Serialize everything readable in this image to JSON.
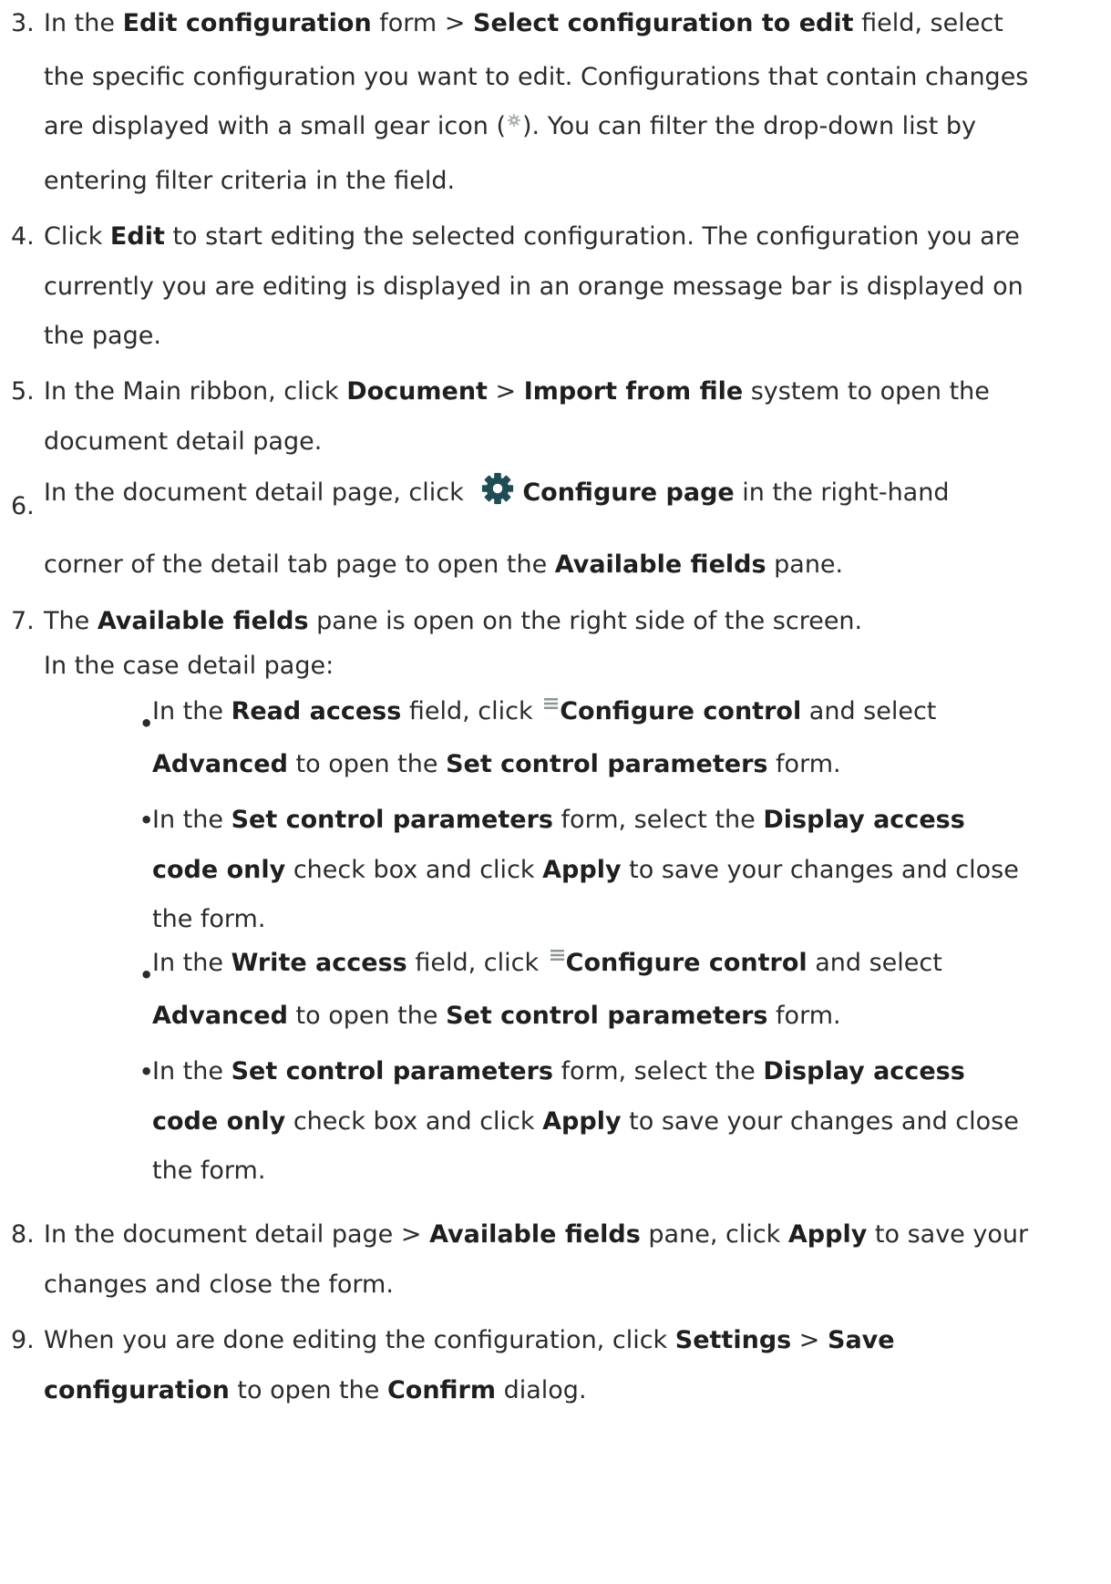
{
  "steps": {
    "s3": {
      "num": "3.",
      "l1a": "In the ",
      "l1b": "Edit configuration",
      "l1c": " form > ",
      "l1d": "Select configuration to edit",
      "l1e": " field, select",
      "l2": "the specific configuration you want to edit. Configurations that contain changes",
      "l3a": "are displayed with a small gear icon (",
      "l3b": "). You can filter the drop-down list by",
      "l4": "entering filter criteria in the field."
    },
    "s4": {
      "num": "4.",
      "l1a": "Click ",
      "l1b": "Edit",
      "l1c": " to start editing the selected configuration. The configuration you are",
      "l2": "currently you are editing is displayed in an orange message bar is displayed on",
      "l3": "the page."
    },
    "s5": {
      "num": "5.",
      "l1a": "In the Main ribbon, click ",
      "l1b": "Document",
      "l1c": " > ",
      "l1d": "Import from file",
      "l1e": " system to open the",
      "l2": "document detail page."
    },
    "s6": {
      "num": "6.",
      "l1a": "In the document detail page, click ",
      "l1b": "Configure page",
      "l1c": " in the right-hand",
      "l2a": "corner of the detail tab page to open the ",
      "l2b": "Available fields",
      "l2c": " pane."
    },
    "s7": {
      "num": "7.",
      "l1a": "The ",
      "l1b": "Available fields",
      "l1c": " pane is open on the right side of the screen.",
      "l2": "In the case detail page:",
      "b1": {
        "l1a": "In the ",
        "l1b": "Read access",
        "l1c": " field, click ",
        "l1d": "Configure control",
        "l1e": " and select",
        "l2a": "Advanced",
        "l2b": " to open the ",
        "l2c": "Set control parameters",
        "l2d": " form."
      },
      "b2": {
        "l1a": "In the ",
        "l1b": "Set control parameters",
        "l1c": " form, select the ",
        "l1d": "Display access",
        "l2a": "code only",
        "l2b": " check box and click ",
        "l2c": "Apply",
        "l2d": " to save your changes and close",
        "l3": "the form."
      },
      "b3": {
        "l1a": "In the ",
        "l1b": "Write access",
        "l1c": " field, click ",
        "l1d": "Configure control",
        "l1e": " and select",
        "l2a": "Advanced",
        "l2b": " to open the ",
        "l2c": "Set control parameters",
        "l2d": " form."
      },
      "b4": {
        "l1a": "In the ",
        "l1b": "Set control parameters",
        "l1c": " form, select the ",
        "l1d": "Display access",
        "l2a": "code only",
        "l2b": " check box and click ",
        "l2c": "Apply",
        "l2d": " to save your changes and close",
        "l3": "the form."
      }
    },
    "s8": {
      "num": "8.",
      "l1a": "In the document detail page > ",
      "l1b": "Available fields",
      "l1c": " pane, click ",
      "l1d": "Apply",
      "l1e": " to save your",
      "l2": "changes and close the form."
    },
    "s9": {
      "num": "9.",
      "l1a": "When you are done editing the configuration, click ",
      "l1b": "Settings",
      "l1c": " > ",
      "l1d": "Save",
      "l2a": "configuration",
      "l2b": " to open the ",
      "l2c": "Confirm",
      "l2d": " dialog."
    }
  },
  "bullet_glyph": "•",
  "icons": {
    "small_gear": "gear-icon",
    "configure_page": "gear-icon",
    "configure_control": "lines-icon"
  },
  "colors": {
    "text": "#2b2b2b",
    "gear": "#1f4c55",
    "small_gear": "#aab0b3"
  }
}
